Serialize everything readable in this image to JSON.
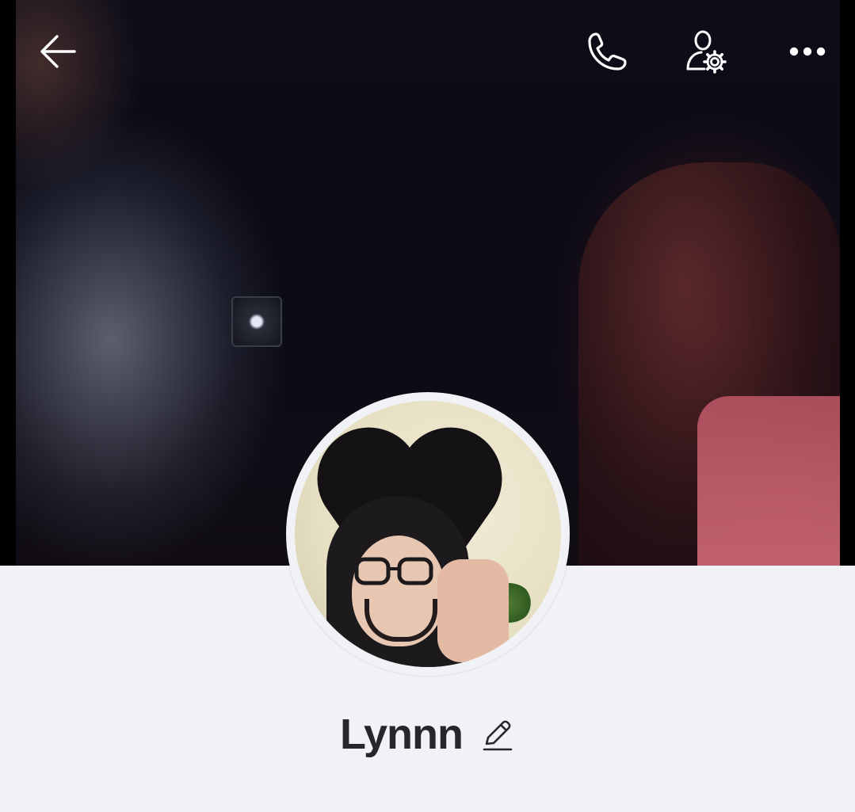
{
  "profile": {
    "name": "Lynnn"
  },
  "top_bar": {
    "icons": [
      "back-arrow-icon",
      "phone-icon",
      "user-settings-icon",
      "more-dots-icon"
    ]
  },
  "colors": {
    "background": "#f1f2f6",
    "name_text": "#25272b",
    "top_icons": "#ffffff"
  }
}
